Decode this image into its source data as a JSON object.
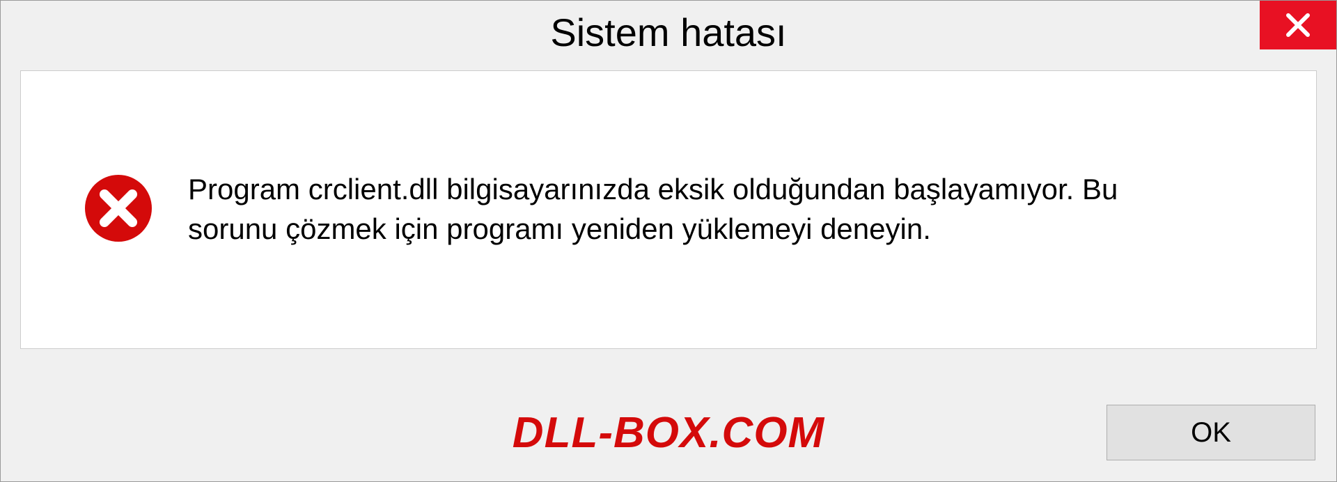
{
  "dialog": {
    "title": "Sistem hatası",
    "message": "Program crclient.dll bilgisayarınızda eksik olduğundan başlayamıyor. Bu sorunu çözmek için programı yeniden yüklemeyi deneyin.",
    "ok_label": "OK"
  },
  "watermark": {
    "text": "DLL-BOX.COM"
  },
  "colors": {
    "close_bg": "#e81123",
    "error_red": "#d40a0a"
  }
}
